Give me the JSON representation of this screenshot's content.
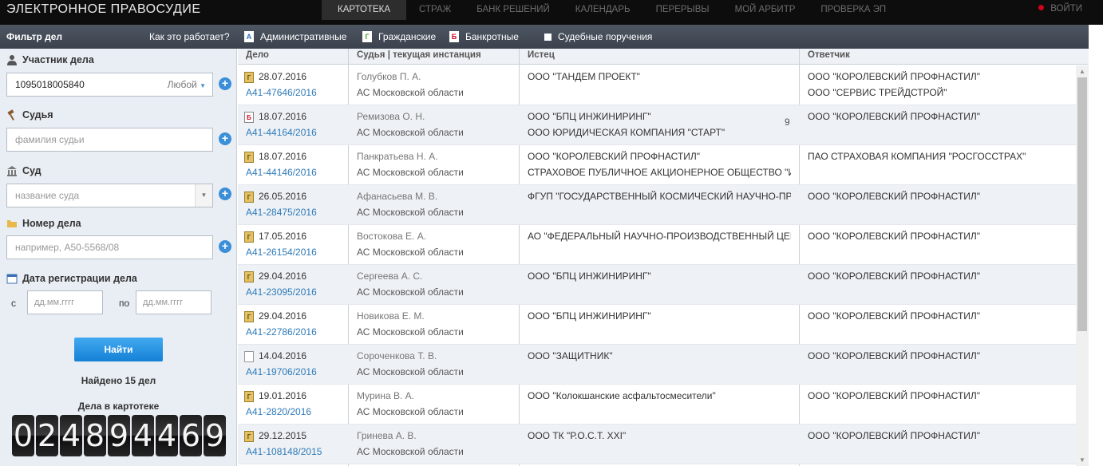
{
  "app_title": "ЭЛЕКТРОННОЕ ПРАВОСУДИЕ",
  "nav": [
    {
      "label": "КАРТОТЕКА",
      "active": true
    },
    {
      "label": "СТРАЖ",
      "active": false
    },
    {
      "label": "БАНК РЕШЕНИЙ",
      "active": false
    },
    {
      "label": "КАЛЕНДАРЬ",
      "active": false
    },
    {
      "label": "ПЕРЕРЫВЫ",
      "active": false
    },
    {
      "label": "МОЙ АРБИТР",
      "active": false
    },
    {
      "label": "ПРОВЕРКА ЭП",
      "active": false
    }
  ],
  "exit_label": "ВОЙТИ",
  "filterbar": {
    "title": "Фильтр дел",
    "how": "Как это работает?",
    "types": [
      {
        "letter": "А",
        "label": "Административные",
        "color": "#2e6fb5"
      },
      {
        "letter": "Г",
        "label": "Гражданские",
        "color": "#4a9a2a"
      },
      {
        "letter": "Б",
        "label": "Банкротные",
        "color": "#d0021b"
      },
      {
        "letter": "",
        "label": "Судебные поручения",
        "color": "#888888"
      }
    ]
  },
  "filter": {
    "participant_label": "Участник дела",
    "participant_value": "1095018005840",
    "participant_mode": "Любой",
    "judge_label": "Судья",
    "judge_placeholder": "фамилия судьи",
    "court_label": "Суд",
    "court_placeholder": "название суда",
    "case_label": "Номер дела",
    "case_placeholder": "например, А50-5568/08",
    "date_label": "Дата регистрации дела",
    "from_label": "с",
    "to_label": "по",
    "date_placeholder": "дд.мм.гггг",
    "find_button": "Найти",
    "found_text": "Найдено 15 дел",
    "cases_text": "Дела в картотеке",
    "counter": [
      "0",
      "2",
      "4",
      "8",
      "9",
      "4",
      "4",
      "6",
      "9"
    ]
  },
  "columns": {
    "case": "Дело",
    "judge": "Судья | текущая инстанция",
    "plaintiff": "Истец",
    "defendant": "Ответчик"
  },
  "rows": [
    {
      "type": "Г",
      "date": "28.07.2016",
      "num": "А41-47646/2016",
      "judge": "Голубков П. А.",
      "court": "АС Московской области",
      "p1": "ООО \"ТАНДЕМ ПРОЕКТ\"",
      "p2": "",
      "extra": "",
      "r1": "ООО \"КОРОЛЕВСКИЙ ПРОФНАСТИЛ\"",
      "r2": "ООО \"СЕРВИС ТРЕЙДСТРОЙ\""
    },
    {
      "type": "Б",
      "date": "18.07.2016",
      "num": "А41-44164/2016",
      "judge": "Ремизова О. Н.",
      "court": "АС Московской области",
      "p1": "ООО \"БПЦ ИНЖИНИРИНГ\"",
      "p2": "ООО ЮРИДИЧЕСКАЯ КОМПАНИЯ \"СТАРТ\"",
      "extra": "9",
      "r1": "ООО \"КОРОЛЕВСКИЙ ПРОФНАСТИЛ\"",
      "r2": ""
    },
    {
      "type": "Г",
      "date": "18.07.2016",
      "num": "А41-44146/2016",
      "judge": "Панкратьева Н. А.",
      "court": "АС Московской области",
      "p1": "ООО \"КОРОЛЕВСКИЙ ПРОФНАСТИЛ\"",
      "p2": "СТРАХОВОЕ ПУБЛИЧНОЕ АКЦИОНЕРНОЕ ОБЩЕСТВО \"ИНГОССТРАХ\"",
      "extra": "",
      "r1": "ПАО СТРАХОВАЯ КОМПАНИЯ \"РОСГОССТРАХ\"",
      "r2": ""
    },
    {
      "type": "Г",
      "date": "26.05.2016",
      "num": "А41-28475/2016",
      "judge": "Афанасьева М. В.",
      "court": "АС Московской области",
      "p1": "ФГУП \"ГОСУДАРСТВЕННЫЙ КОСМИЧЕСКИЙ НАУЧНО-ПРОИЗВОДСТВЕННЫЙ ЦЕНТР\"",
      "p2": "",
      "extra": "",
      "r1": "ООО \"КОРОЛЕВСКИЙ ПРОФНАСТИЛ\"",
      "r2": ""
    },
    {
      "type": "Г",
      "date": "17.05.2016",
      "num": "А41-26154/2016",
      "judge": "Востокова Е. А.",
      "court": "АС Московской области",
      "p1": "АО \"ФЕДЕРАЛЬНЫЙ НАУЧНО-ПРОИЗВОДСТВЕННЫЙ ЦЕНТР\"",
      "p2": "",
      "extra": "",
      "r1": "ООО \"КОРОЛЕВСКИЙ ПРОФНАСТИЛ\"",
      "r2": ""
    },
    {
      "type": "Г",
      "date": "29.04.2016",
      "num": "А41-23095/2016",
      "judge": "Сергеева А. С.",
      "court": "АС Московской области",
      "p1": "ООО \"БПЦ ИНЖИНИРИНГ\"",
      "p2": "",
      "extra": "",
      "r1": "ООО \"КОРОЛЕВСКИЙ ПРОФНАСТИЛ\"",
      "r2": ""
    },
    {
      "type": "Г",
      "date": "29.04.2016",
      "num": "А41-22786/2016",
      "judge": "Новикова Е. М.",
      "court": "АС Московской области",
      "p1": "ООО \"БПЦ ИНЖИНИРИНГ\"",
      "p2": "",
      "extra": "",
      "r1": "ООО \"КОРОЛЕВСКИЙ ПРОФНАСТИЛ\"",
      "r2": ""
    },
    {
      "type": "",
      "date": "14.04.2016",
      "num": "А41-19706/2016",
      "judge": "Сороченкова Т. В.",
      "court": "АС Московской области",
      "p1": "ООО \"ЗАЩИТНИК\"",
      "p2": "",
      "extra": "",
      "r1": "ООО \"КОРОЛЕВСКИЙ ПРОФНАСТИЛ\"",
      "r2": ""
    },
    {
      "type": "Г",
      "date": "19.01.2016",
      "num": "А41-2820/2016",
      "judge": "Мурина В. А.",
      "court": "АС Московской области",
      "p1": "ООО \"Колокшанские асфальтосмесители\"",
      "p2": "",
      "extra": "",
      "r1": "ООО \"КОРОЛЕВСКИЙ ПРОФНАСТИЛ\"",
      "r2": ""
    },
    {
      "type": "Г",
      "date": "29.12.2015",
      "num": "А41-108148/2015",
      "judge": "Гринева А. В.",
      "court": "АС Московской области",
      "p1": "ООО ТК \"Р.О.С.Т. XXI\"",
      "p2": "",
      "extra": "",
      "r1": "ООО \"КОРОЛЕВСКИЙ ПРОФНАСТИЛ\"",
      "r2": ""
    }
  ]
}
